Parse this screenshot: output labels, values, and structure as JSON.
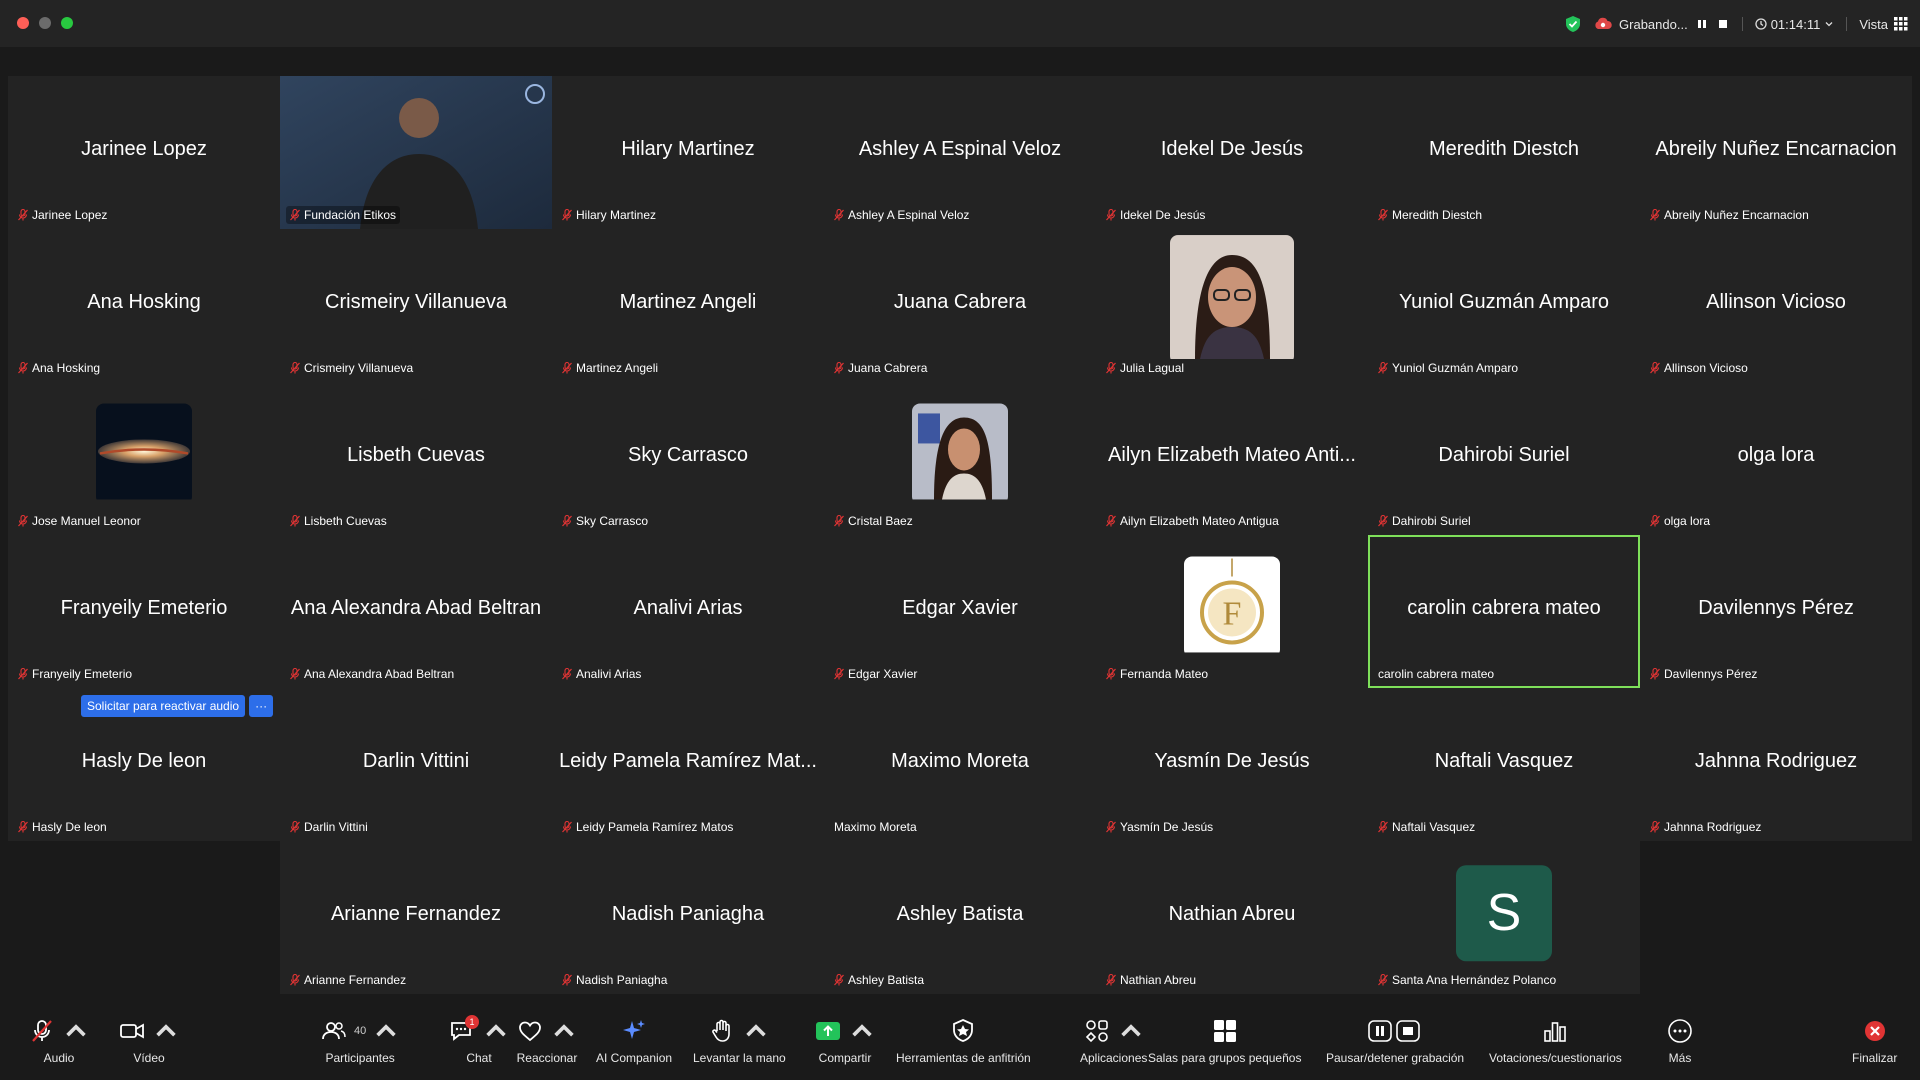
{
  "titlebar": {
    "recording_label": "Grabando...",
    "timer": "01:14:11",
    "view_label": "Vista"
  },
  "tiles": [
    {
      "center": "Jarinee Lopez",
      "label": "Jarinee Lopez",
      "muted": true
    },
    {
      "center": "",
      "label": "Fundación Etikos",
      "muted": true,
      "video": "fundacion"
    },
    {
      "center": "Hilary Martinez",
      "label": "Hilary Martinez",
      "muted": true
    },
    {
      "center": "Ashley A Espinal Veloz",
      "label": "Ashley A Espinal Veloz",
      "muted": true
    },
    {
      "center": "Idekel De Jesús",
      "label": "Idekel De Jesús",
      "muted": true
    },
    {
      "center": "Meredith Diestch",
      "label": "Meredith Diestch",
      "muted": true
    },
    {
      "center": "Abreily Nuñez Encarnacion",
      "label": "Abreily Nuñez Encarnacion",
      "muted": true
    },
    {
      "center": "Ana Hosking",
      "label": "Ana Hosking",
      "muted": true
    },
    {
      "center": "Crismeiry Villanueva",
      "label": "Crismeiry Villanueva",
      "muted": true
    },
    {
      "center": "Martinez Angeli",
      "label": "Martinez Angeli",
      "muted": true
    },
    {
      "center": "Juana Cabrera",
      "label": "Juana Cabrera",
      "muted": true
    },
    {
      "center": "",
      "label": "Julia Lagual",
      "muted": true,
      "avatar": "julia"
    },
    {
      "center": "Yuniol Guzmán Amparo",
      "label": "Yuniol Guzmán Amparo",
      "muted": true
    },
    {
      "center": "Allinson Vicioso",
      "label": "Allinson Vicioso",
      "muted": true
    },
    {
      "center": "",
      "label": "Jose Manuel Leonor",
      "muted": true,
      "avatar": "galaxy"
    },
    {
      "center": "Lisbeth Cuevas",
      "label": "Lisbeth Cuevas",
      "muted": true
    },
    {
      "center": "Sky Carrasco",
      "label": "Sky Carrasco",
      "muted": true
    },
    {
      "center": "",
      "label": "Cristal Baez",
      "muted": true,
      "avatar": "cristal"
    },
    {
      "center": "Ailyn Elizabeth Mateo Anti...",
      "label": "Ailyn Elizabeth Mateo Antigua",
      "muted": true
    },
    {
      "center": "Dahirobi Suriel",
      "label": "Dahirobi Suriel",
      "muted": true
    },
    {
      "center": "olga lora",
      "label": "olga lora",
      "muted": true
    },
    {
      "center": "Franyeily Emeterio",
      "label": "Franyeily Emeterio",
      "muted": true
    },
    {
      "center": "Ana Alexandra Abad Beltran",
      "label": "Ana Alexandra Abad Beltran",
      "muted": true
    },
    {
      "center": "Analivi Arias",
      "label": "Analivi Arias",
      "muted": true
    },
    {
      "center": "Edgar Xavier",
      "label": "Edgar Xavier",
      "muted": true
    },
    {
      "center": "",
      "label": "Fernanda Mateo",
      "muted": true,
      "avatar": "pendant"
    },
    {
      "center": "carolin cabrera mateo",
      "label": "carolin cabrera mateo",
      "muted": false,
      "speaking": true
    },
    {
      "center": "Davilennys Pérez",
      "label": "Davilennys Pérez",
      "muted": true
    },
    {
      "center": "Hasly De leon",
      "label": "Hasly De leon",
      "muted": true
    },
    {
      "center": "Darlin Vittini",
      "label": "Darlin Vittini",
      "muted": true
    },
    {
      "center": "Leidy Pamela Ramírez Mat...",
      "label": "Leidy Pamela Ramírez Matos",
      "muted": true
    },
    {
      "center": "Maximo Moreta",
      "label": "Maximo Moreta",
      "muted": false
    },
    {
      "center": "Yasmín De Jesús",
      "label": "Yasmín De Jesús",
      "muted": true
    },
    {
      "center": "Naftali Vasquez",
      "label": "Naftali Vasquez",
      "muted": true
    },
    {
      "center": "Jahnna Rodriguez",
      "label": "Jahnna Rodriguez",
      "muted": true
    },
    {
      "center": "Arianne Fernandez",
      "label": "Arianne Fernandez",
      "muted": true
    },
    {
      "center": "Nadish Paniagha",
      "label": "Nadish Paniagha",
      "muted": true
    },
    {
      "center": "Ashley Batista",
      "label": "Ashley Batista",
      "muted": true
    },
    {
      "center": "Nathian Abreu",
      "label": "Nathian Abreu",
      "muted": true
    },
    {
      "center": "",
      "label": "Santa Ana Hernández Polanco",
      "muted": true,
      "letter": "S"
    }
  ],
  "reactivar": {
    "label": "Solicitar para reactivar audio",
    "more": "···"
  },
  "toolbar": {
    "audio": "Audio",
    "video": "Vídeo",
    "participants": "Participantes",
    "participants_count": "40",
    "chat": "Chat",
    "chat_badge": "1",
    "react": "Reaccionar",
    "ai": "AI Companion",
    "raise_hand": "Levantar la mano",
    "share": "Compartir",
    "host_tools": "Herramientas de anfitrión",
    "apps": "Aplicaciones",
    "breakout": "Salas para grupos pequeños",
    "pause_rec": "Pausar/detener grabación",
    "polls": "Votaciones/cuestionarios",
    "more": "Más",
    "end": "Finalizar"
  },
  "colors": {
    "accent_green": "#7ee05a",
    "share_green": "#23c35a",
    "end_red": "#e03434",
    "blue": "#2d6ee9"
  }
}
